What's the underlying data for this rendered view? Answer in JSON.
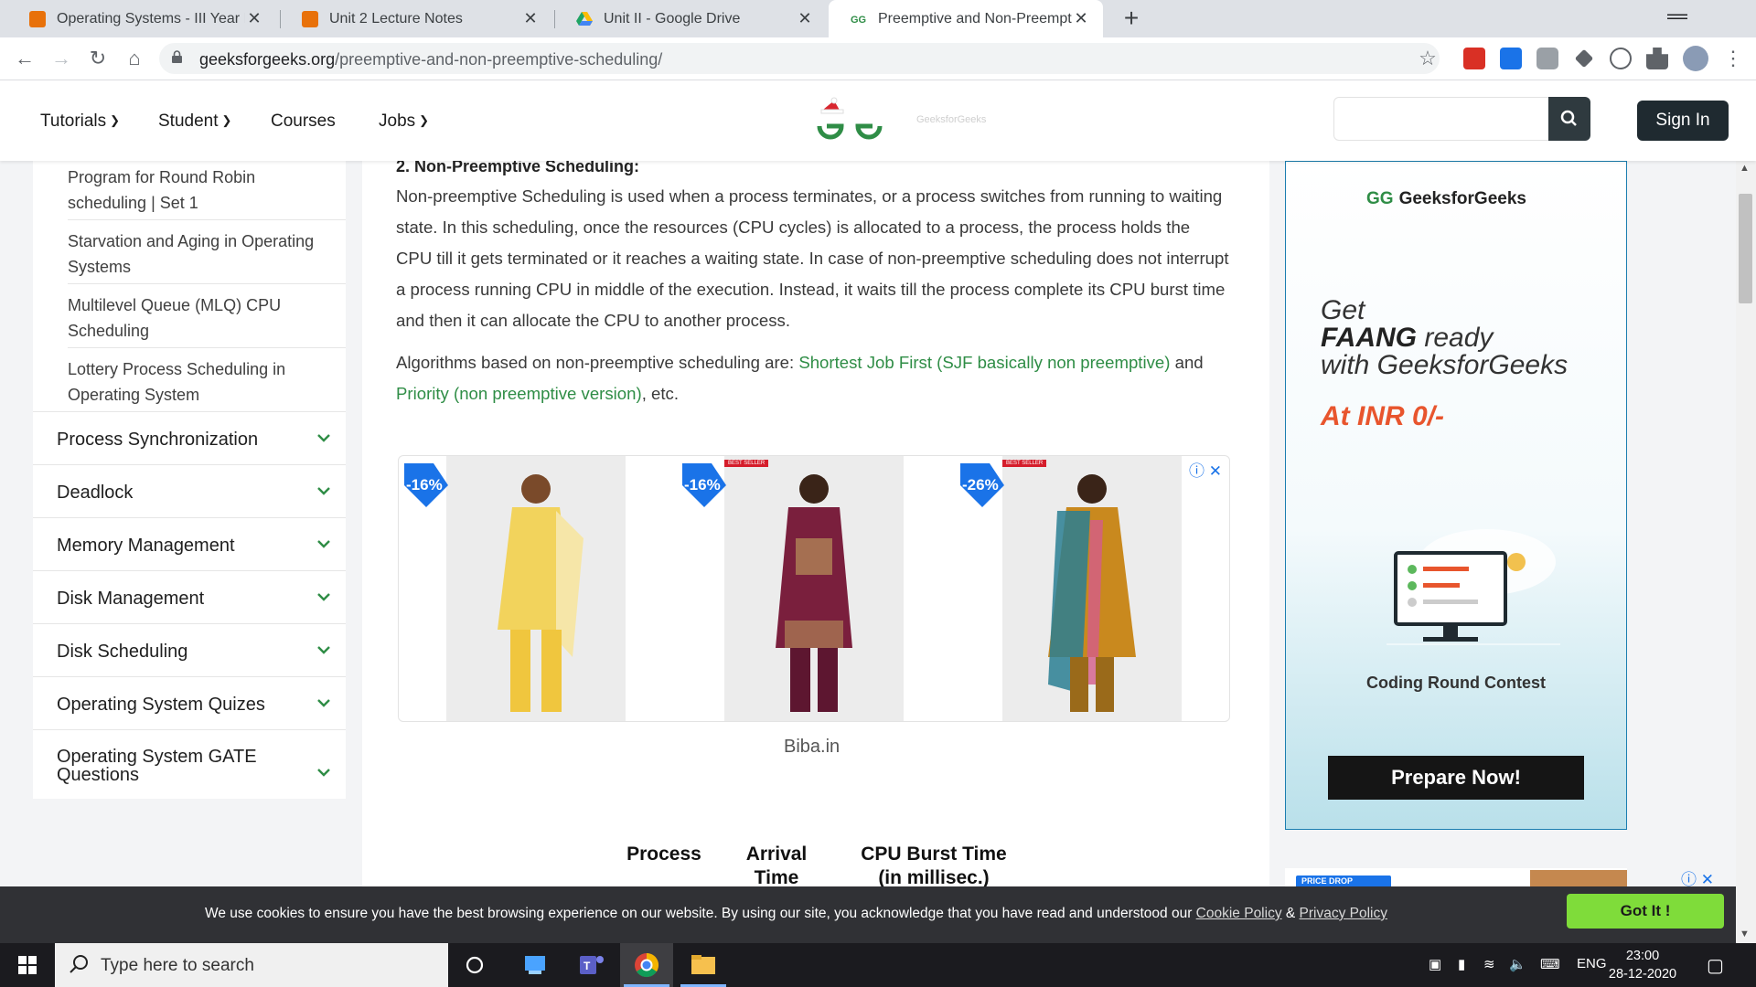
{
  "browser": {
    "tabs": [
      {
        "title": "Operating Systems - III Year IT (B.",
        "favicon_color": "#e8710a",
        "active": false
      },
      {
        "title": "Unit 2 Lecture Notes",
        "favicon_color": "#e8710a",
        "active": false
      },
      {
        "title": "Unit II - Google Drive",
        "favicon_color": "#1fa463",
        "active": false
      },
      {
        "title": "Preemptive and Non-Preemptive",
        "favicon_color": "#2f8d46",
        "active": true
      }
    ],
    "tab_close": "✕",
    "new_tab": "+",
    "url_domain": "geeksforgeeks.org",
    "url_path": "/preemptive-and-non-preemptive-scheduling/",
    "icons": {
      "back": "←",
      "forward": "→",
      "reload": "↻",
      "home": "⌂",
      "star": "☆",
      "minimize": "—",
      "maximize": "❐",
      "close": "✕",
      "menu": "⋮"
    }
  },
  "site_header": {
    "menu": [
      {
        "label": "Tutorials",
        "has_dropdown": true
      },
      {
        "label": "Student",
        "has_dropdown": true
      },
      {
        "label": "Courses",
        "has_dropdown": false
      },
      {
        "label": "Jobs",
        "has_dropdown": true
      }
    ],
    "logo_text": "GeeksforGeeks",
    "search_placeholder": "",
    "signin_label": "Sign In"
  },
  "sidebar": {
    "sub_items": [
      "Program for Round Robin scheduling | Set 1",
      "Starvation and Aging in Operating Systems",
      "Multilevel Queue (MLQ) CPU Scheduling",
      "Lottery Process Scheduling in Operating System"
    ],
    "categories": [
      "Process Synchronization",
      "Deadlock",
      "Memory Management",
      "Disk Management",
      "Disk Scheduling",
      "Operating System Quizes",
      "Operating System GATE Questions"
    ]
  },
  "article": {
    "heading": "2. Non-Preemptive Scheduling:",
    "paragraph": "Non-preemptive Scheduling is used when a process terminates, or a process switches from running to waiting state. In this scheduling, once the resources (CPU cycles) is allocated to a process, the process holds the CPU till it gets terminated or it reaches a waiting state. In case of non-preemptive scheduling does not interrupt a process running CPU in middle of the execution. Instead, it waits till the process complete its CPU burst time and then it can allocate the CPU to another process.",
    "algos_prefix": "Algorithms based on non-preemptive scheduling are: ",
    "link_sjf": "Shortest Job First (SJF basically non preemptive)",
    "algos_middle": " and ",
    "link_priority": "Priority (non preemptive version)",
    "algos_suffix": ", etc.",
    "ad": {
      "products": [
        {
          "discount": "-16%",
          "best_seller": false,
          "dress_color": "#f2d35c"
        },
        {
          "discount": "-16%",
          "best_seller": true,
          "dress_color": "#7a1f3d"
        },
        {
          "discount": "-26%",
          "best_seller": true,
          "dress_color": "#c9891e"
        }
      ],
      "best_seller_label": "BEST SELLER",
      "source": "Biba.in",
      "close_icon": "ⓘ ✕"
    },
    "table_headers": [
      "Process",
      "Arrival Time",
      "CPU Burst Time (in millisec.)"
    ]
  },
  "right_ad": {
    "logo": "GeeksforGeeks",
    "line1": "Get",
    "line2_bold": "FAANG",
    "line2_rest": " ready",
    "line3": "with GeeksforGeeks",
    "price": "At INR 0/-",
    "contest": "Coding Round Contest",
    "button": "Prepare Now!",
    "second_ad_tag": "PRICE DROP",
    "second_ad_close": "ⓘ ✕"
  },
  "cookie": {
    "message": "We use cookies to ensure you have the best browsing experience on our website. By using our site, you acknowledge that you have read and understood our ",
    "cookie_policy": "Cookie Policy",
    "amp": " & ",
    "privacy_policy": "Privacy Policy",
    "button": "Got It !"
  },
  "taskbar": {
    "search_placeholder": "Type here to search",
    "lang": "ENG",
    "time": "23:00",
    "date": "28-12-2020"
  },
  "colors": {
    "gfg_green": "#2f8d46",
    "header_dark": "#1f2a30",
    "cookie_bg": "#303135",
    "gotit_green": "#7fdc3a",
    "price_orange": "#e8552d"
  }
}
